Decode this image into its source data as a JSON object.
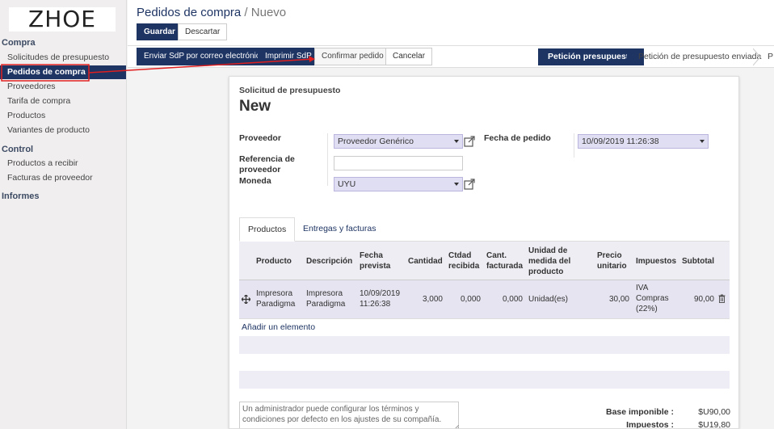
{
  "logo": "ZHOE",
  "sidebar": {
    "sections": [
      {
        "title": "Compra",
        "items": [
          "Solicitudes de presupuesto",
          "Pedidos de compra",
          "Proveedores",
          "Tarifa de compra",
          "Productos",
          "Variantes de producto"
        ]
      },
      {
        "title": "Control",
        "items": [
          "Productos a recibir",
          "Facturas de proveedor"
        ]
      },
      {
        "title": "Informes",
        "items": []
      }
    ],
    "active_item": "Pedidos de compra"
  },
  "breadcrumb": {
    "parent": "Pedidos de compra",
    "separator": "/",
    "current": "Nuevo"
  },
  "toolbar": {
    "save_label": "Guardar",
    "discard_label": "Descartar"
  },
  "actions": {
    "send_rfq": "Enviar SdP por correo electrónico",
    "print_rfq": "Imprimir SdP",
    "confirm": "Confirmar pedido",
    "cancel": "Cancelar"
  },
  "stages": {
    "active": "Petición presupuesto",
    "next": "Petición de presupuesto enviada",
    "more": "P"
  },
  "form": {
    "subtitle": "Solicitud de presupuesto",
    "title": "New",
    "vendor_label": "Proveedor",
    "vendor_value": "Proveedor Genérico",
    "vendor_ref_label": "Referencia de proveedor",
    "vendor_ref_value": "",
    "currency_label": "Moneda",
    "currency_value": "UYU",
    "order_date_label": "Fecha de pedido",
    "order_date_value": "10/09/2019 11:26:38"
  },
  "tabs": [
    "Productos",
    "Entregas y facturas"
  ],
  "lines": {
    "headers": [
      "Producto",
      "Descripción",
      "Fecha prevista",
      "Cantidad",
      "Ctdad recibida",
      "Cant. facturada",
      "Unidad de medida del producto",
      "Precio unitario",
      "Impuestos",
      "Subtotal"
    ],
    "rows": [
      {
        "product": "Impresora Paradigma",
        "description": "Impresora Paradigma",
        "date": "10/09/2019 11:26:38",
        "qty": "3,000",
        "received": "0,000",
        "invoiced": "0,000",
        "uom": "Unidad(es)",
        "price": "30,00",
        "taxes": "IVA Compras (22%)",
        "subtotal": "90,00"
      }
    ],
    "add_line": "Añadir un elemento"
  },
  "notes_placeholder": "Un administrador puede configurar los términos y condiciones por defecto en los ajustes de su compañía.",
  "totals": {
    "base_label": "Base imponible :",
    "base_value": "$U90,00",
    "tax_label": "Impuestos :",
    "tax_value": "$U19,80"
  },
  "colors": {
    "brand": "#1e3463",
    "annotation": "#e02020",
    "selection": "#e0def2"
  }
}
